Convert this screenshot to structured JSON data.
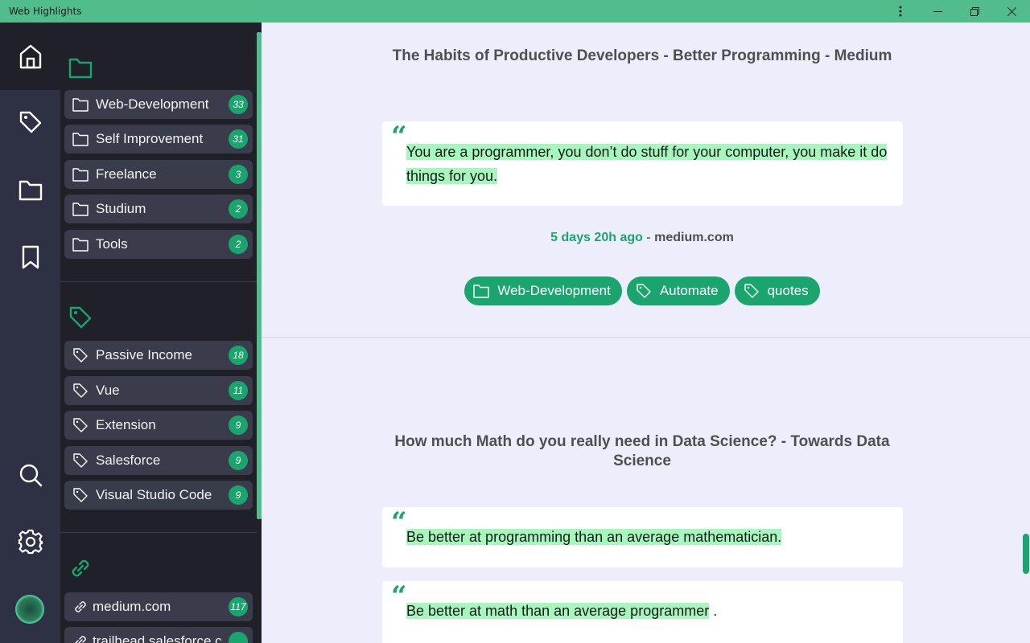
{
  "window": {
    "title": "Web Highlights"
  },
  "folders": [
    {
      "label": "Web-Development",
      "count": "33"
    },
    {
      "label": "Self Improvement",
      "count": "31"
    },
    {
      "label": "Freelance",
      "count": "3"
    },
    {
      "label": "Studium",
      "count": "2"
    },
    {
      "label": "Tools",
      "count": "2"
    }
  ],
  "tags": [
    {
      "label": "Passive Income",
      "count": "18"
    },
    {
      "label": "Vue",
      "count": "11"
    },
    {
      "label": "Extension",
      "count": "9"
    },
    {
      "label": "Salesforce",
      "count": "9"
    },
    {
      "label": "Visual Studio Code",
      "count": "9"
    }
  ],
  "domains": [
    {
      "label": "medium.com",
      "count": "117"
    },
    {
      "label": "trailhead.salesforce.c",
      "count": ""
    }
  ],
  "cards": [
    {
      "title": "The Habits of Productive Developers - Better Programming - Medium",
      "highlights": [
        {
          "text": "You are a programmer, you don’t do stuff for your computer, you make it do things for you.",
          "suffix": ""
        }
      ],
      "time": "5 days 20h ago -",
      "site": "medium.com",
      "chips": [
        {
          "icon": "folder-icon",
          "label": "Web-Development"
        },
        {
          "icon": "tag-icon",
          "label": "Automate"
        },
        {
          "icon": "tag-icon",
          "label": "quotes"
        }
      ]
    },
    {
      "title": "How much Math do you really need in Data Science? - Towards Data Science",
      "highlights": [
        {
          "text": "Be better at programming than an average mathematician.",
          "suffix": ""
        },
        {
          "text": "Be better at math than an average programmer",
          "suffix": " ."
        }
      ]
    }
  ],
  "colors": {
    "accent": "#1ba56e",
    "titlebar": "#52bd8c",
    "highlight": "#a6f7bd",
    "rail": "#2e3043",
    "panel": "#1f2028"
  }
}
